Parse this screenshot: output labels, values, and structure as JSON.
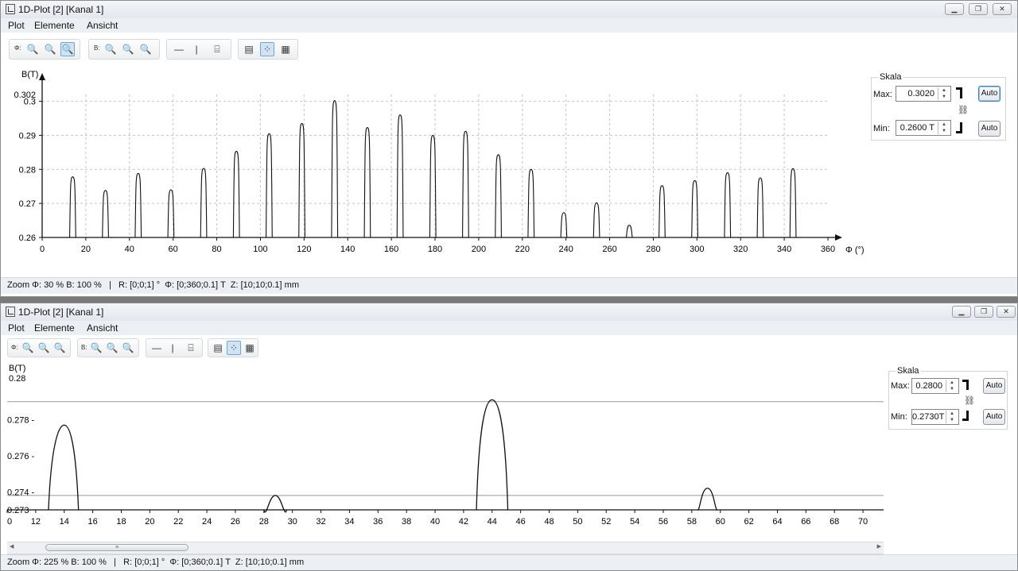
{
  "windows": [
    {
      "title": "1D-Plot [2]  [Kanal 1]",
      "menu": [
        "Plot",
        "Elemente",
        "Ansicht"
      ],
      "toolbar": {
        "phi_label": "Φ:",
        "b_label": "B:"
      },
      "status": "Zoom Φ: 30 % B: 100 %   |   R: [0;0;1] °  Φ: [0;360;0.1] T  Z: [10;10;0.1] mm",
      "scale": {
        "title": "Skala",
        "max_label": "Max:",
        "min_label": "Min:",
        "max_value": "0.3020",
        "min_value": "0.2600 T",
        "auto_label": "Auto"
      }
    },
    {
      "title": "1D-Plot [2]  [Kanal 1]",
      "menu": [
        "Plot",
        "Elemente",
        "Ansicht"
      ],
      "toolbar": {
        "phi_label": "Φ:",
        "b_label": "B:"
      },
      "status": "Zoom Φ: 225 % B: 100 %   |   R: [0;0;1] °  Φ: [0;360;0.1] T  Z: [10;10;0.1] mm",
      "scale": {
        "title": "Skala",
        "max_label": "Max:",
        "min_label": "Min:",
        "max_value": "0.2800",
        "min_value": "0.2730T",
        "auto_label": "Auto"
      }
    }
  ],
  "chart_data": [
    {
      "type": "line",
      "ylabel": "B(T)",
      "xlabel": "Φ (°)",
      "xlim": [
        0,
        360
      ],
      "ylim": [
        0.26,
        0.302
      ],
      "xticks": [
        0,
        20,
        40,
        60,
        80,
        100,
        120,
        140,
        160,
        180,
        200,
        220,
        240,
        260,
        280,
        300,
        320,
        340,
        360
      ],
      "yticks": [
        0.26,
        0.27,
        0.28,
        0.29,
        0.3
      ],
      "ytick_labels": [
        "0.26",
        "0.27",
        "0.28",
        "0.29",
        "0.3"
      ],
      "ymax_label": "0.302",
      "grid": true,
      "peaks": [
        {
          "x": 14,
          "y": 0.2778
        },
        {
          "x": 29,
          "y": 0.2738
        },
        {
          "x": 44,
          "y": 0.2788
        },
        {
          "x": 59,
          "y": 0.274
        },
        {
          "x": 74,
          "y": 0.2803
        },
        {
          "x": 89,
          "y": 0.2853
        },
        {
          "x": 104,
          "y": 0.2905
        },
        {
          "x": 119,
          "y": 0.2935
        },
        {
          "x": 134,
          "y": 0.3002
        },
        {
          "x": 149,
          "y": 0.2923
        },
        {
          "x": 164,
          "y": 0.296
        },
        {
          "x": 179,
          "y": 0.29
        },
        {
          "x": 194,
          "y": 0.2912
        },
        {
          "x": 209,
          "y": 0.2843
        },
        {
          "x": 224,
          "y": 0.28
        },
        {
          "x": 239,
          "y": 0.2673
        },
        {
          "x": 254,
          "y": 0.2702
        },
        {
          "x": 269,
          "y": 0.2636
        },
        {
          "x": 284,
          "y": 0.2752
        },
        {
          "x": 299,
          "y": 0.2767
        },
        {
          "x": 314,
          "y": 0.279
        },
        {
          "x": 329,
          "y": 0.2775
        },
        {
          "x": 344,
          "y": 0.2802
        }
      ]
    },
    {
      "type": "line",
      "ylabel": "B(T)",
      "xlim": [
        10,
        71
      ],
      "ylim": [
        0.273,
        0.28
      ],
      "xticks": [
        10,
        12,
        14,
        16,
        18,
        20,
        22,
        24,
        26,
        28,
        30,
        32,
        34,
        36,
        38,
        40,
        42,
        44,
        46,
        48,
        50,
        52,
        54,
        56,
        58,
        60,
        62,
        64,
        66,
        68,
        70
      ],
      "xtick_labels": [
        "0",
        "12",
        "14",
        "16",
        "18",
        "20",
        "22",
        "24",
        "26",
        "28",
        "30",
        "32",
        "34",
        "36",
        "38",
        "40",
        "42",
        "44",
        "46",
        "48",
        "50",
        "52",
        "54",
        "56",
        "58",
        "60",
        "62",
        "64",
        "66",
        "68",
        "70"
      ],
      "yticks": [
        0.273,
        0.274,
        0.276,
        0.278
      ],
      "ytick_labels": [
        "0.273",
        "0.274 -",
        "0.276 -",
        "0.278 -"
      ],
      "ymax_label": "0.28",
      "hlines": [
        0.279,
        0.2738
      ],
      "peaks": [
        {
          "x": 14.0,
          "y": 0.2777,
          "x0": 12.9,
          "x1": 15.0
        },
        {
          "x": 28.8,
          "y": 0.2738,
          "x0": 28.0,
          "x1": 29.6
        },
        {
          "x": 44.0,
          "y": 0.2791,
          "x0": 42.9,
          "x1": 45.1
        },
        {
          "x": 59.1,
          "y": 0.2742,
          "x0": 58.4,
          "x1": 59.8
        }
      ]
    }
  ]
}
